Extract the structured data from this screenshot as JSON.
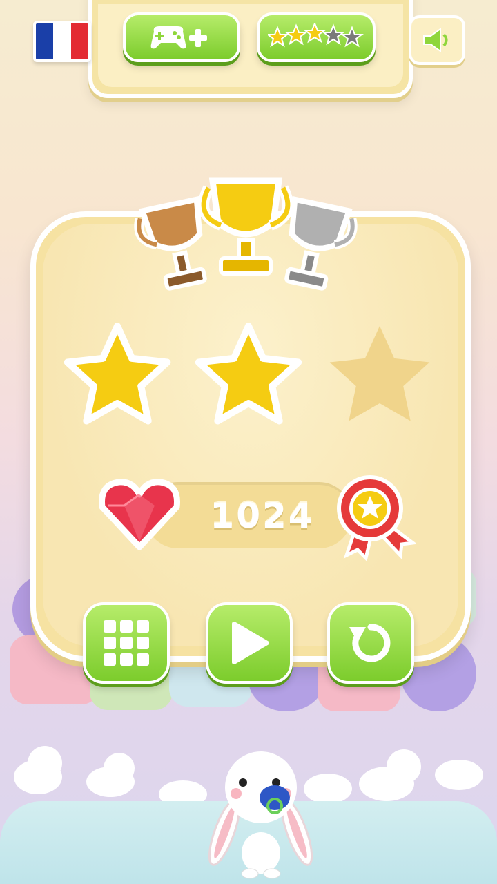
{
  "header": {
    "language_flag": "france-flag",
    "add_game_icon": "gamepad-plus-icon",
    "rating_icon": "stars-rating-icon",
    "rating_stars_filled": 3,
    "rating_stars_total": 5,
    "sound_icon": "speaker-icon"
  },
  "result": {
    "trophies": [
      "bronze-trophy",
      "gold-trophy",
      "silver-trophy"
    ],
    "stars_earned": 2,
    "stars_total": 3,
    "score": "1024",
    "score_icon": "ruby-heart-icon",
    "badge_icon": "award-ribbon-icon"
  },
  "actions": {
    "levels_icon": "grid-icon",
    "play_icon": "play-icon",
    "retry_icon": "restart-icon"
  },
  "colors": {
    "panel": "#f6e2a2",
    "green_button": "#8fd63b",
    "star_gold": "#f5cc12",
    "star_empty": "#f0d48b",
    "gem_red": "#e8344c"
  }
}
